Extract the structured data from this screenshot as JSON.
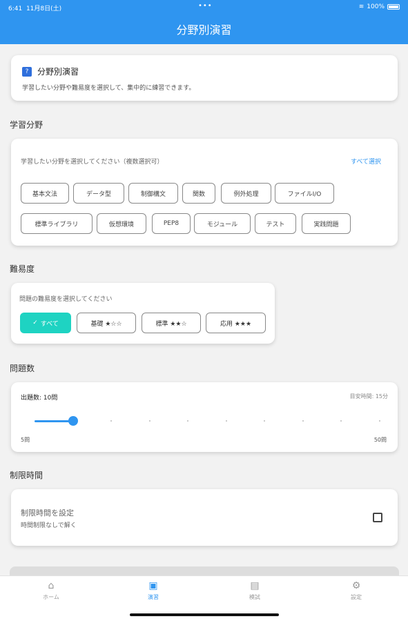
{
  "status": {
    "time": "6:41",
    "date": "11月8日(土)",
    "battery": "100%"
  },
  "appbar": {
    "title": "分野別演習"
  },
  "intro": {
    "title": "分野別演習",
    "description": "学習したい分野や難易度を選択して、集中的に練習できます。"
  },
  "fields_section": {
    "title": "学習分野",
    "hint": "学習したい分野を選択してください（複数選択可）",
    "select_all": "すべて選択",
    "chips": [
      "基本文法",
      "データ型",
      "制御構文",
      "関数",
      "例外処理",
      "ファイルI/O",
      "標準ライブラリ",
      "仮想環境",
      "PEP8",
      "モジュール",
      "テスト",
      "実践問題"
    ]
  },
  "difficulty_section": {
    "title": "難易度",
    "hint": "問題の難易度を選択してください",
    "options": [
      {
        "label": "すべて",
        "selected": true
      },
      {
        "label": "基礎 ★☆☆",
        "selected": false
      },
      {
        "label": "標準 ★★☆",
        "selected": false
      },
      {
        "label": "応用 ★★★",
        "selected": false
      }
    ]
  },
  "count_section": {
    "title": "問題数",
    "label": "出題数: 10問",
    "estimate": "目安時間: 15分",
    "min_label": "5問",
    "max_label": "50問",
    "value": 10,
    "min": 5,
    "max": 50
  },
  "timer_section": {
    "title": "制限時間",
    "label": "制限時間を設定",
    "sublabel": "時間制限なしで解く",
    "checked": false
  },
  "tabs": [
    {
      "label": "ホーム",
      "icon": "home-icon",
      "active": false
    },
    {
      "label": "演習",
      "icon": "quiz-icon",
      "active": true
    },
    {
      "label": "模試",
      "icon": "exam-icon",
      "active": false
    },
    {
      "label": "設定",
      "icon": "gear-icon",
      "active": false
    }
  ],
  "colors": {
    "primary": "#2f95f0",
    "accent": "#1ed3c2"
  }
}
